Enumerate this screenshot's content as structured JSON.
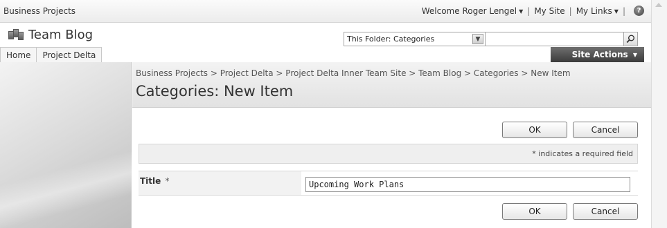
{
  "global": {
    "site_crumb": "Business Projects",
    "welcome": "Welcome Roger Lengel",
    "my_site": "My Site",
    "my_links": "My Links",
    "separator": "|",
    "dropdown_glyph": "▼"
  },
  "title_area": {
    "site_title": "Team Blog",
    "search_scope": "This Folder: Categories"
  },
  "nav": {
    "tabs": [
      "Home",
      "Project Delta"
    ],
    "site_actions": "Site Actions"
  },
  "page": {
    "breadcrumb": "Business Projects > Project Delta > Project Delta Inner Team Site > Team Blog > Categories > New Item",
    "title": "Categories: New Item"
  },
  "form": {
    "ok_label": "OK",
    "cancel_label": "Cancel",
    "required_note": "* indicates a required field",
    "title_label": "Title",
    "required_mark": "*",
    "title_value": "Upcoming Work Plans"
  }
}
